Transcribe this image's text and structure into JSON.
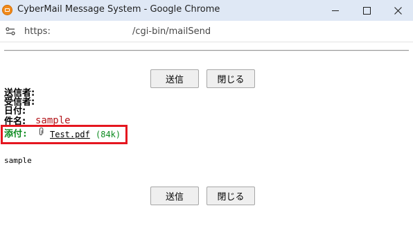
{
  "window": {
    "title": "CyberMail Message System - Google Chrome",
    "app_icon": "cybermail-icon"
  },
  "address_bar": {
    "scheme": "https:",
    "path": "/cgi-bin/mailSend"
  },
  "toolbar_top": {
    "send_label": "送信",
    "close_label": "閉じる"
  },
  "message": {
    "sender_label": "送信者:",
    "recipient_label": "受信者:",
    "date_label": "日付:",
    "subject_label": "件名:",
    "subject_value": "sample",
    "attachment_label": "添付:",
    "attachment_icon": "paperclip-icon",
    "attachment_file": "Test.pdf",
    "attachment_size": "(84k)",
    "body": "sample"
  },
  "toolbar_bottom": {
    "send_label": "送信",
    "close_label": "閉じる"
  },
  "colors": {
    "titlebar_bg": "#dfe8f5",
    "subject_color": "#b3161b",
    "attachment_color": "#0b8a1e",
    "highlight_border": "#e5161f"
  }
}
